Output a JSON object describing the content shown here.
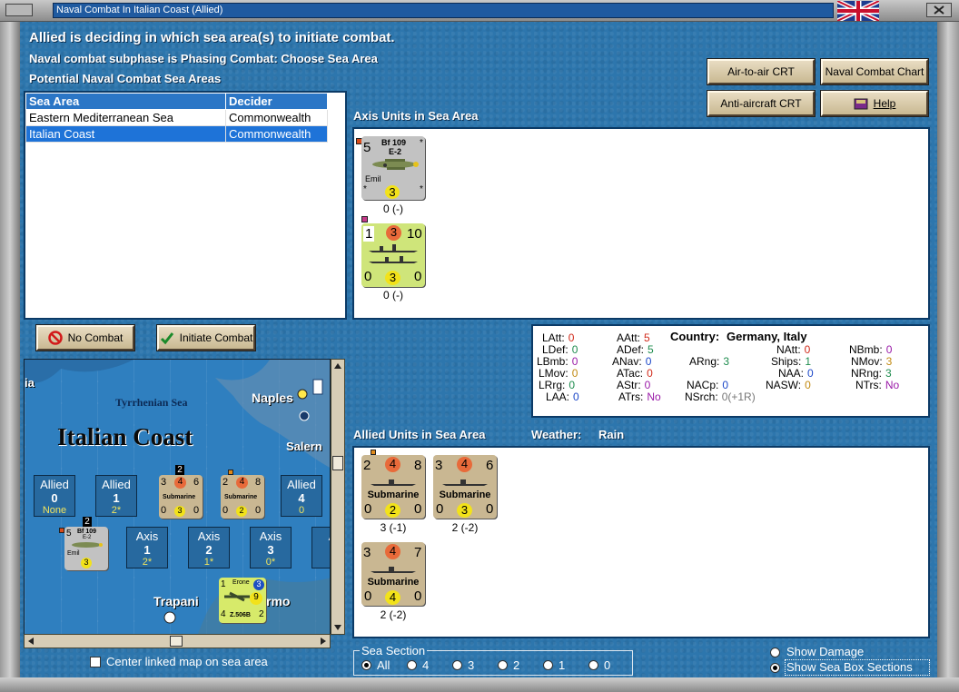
{
  "window": {
    "title": "Naval Combat In Italian Coast (Allied)"
  },
  "header": {
    "line1": "Allied is deciding in which sea area(s) to initiate combat.",
    "line2": "Naval combat subphase is Phasing Combat: Choose Sea Area",
    "line3": "Potential Naval Combat Sea Areas"
  },
  "buttons": {
    "air_to_air": "Air-to-air CRT",
    "naval_chart": "Naval Combat Chart",
    "anti_aircraft": "Anti-aircraft CRT",
    "help": "Help",
    "no_combat": "No Combat",
    "initiate_combat": "Initiate Combat"
  },
  "sea_table": {
    "headers": [
      "Sea Area",
      "Decider"
    ],
    "rows": [
      {
        "area": "Eastern Mediterranean Sea",
        "decider": "Commonwealth",
        "selected": false
      },
      {
        "area": "Italian Coast",
        "decider": "Commonwealth",
        "selected": true
      }
    ]
  },
  "axis_units": {
    "label": "Axis Units in Sea Area",
    "units": [
      {
        "type": "aircraft",
        "name": "Bf 109",
        "variant": "E-2",
        "nick": "Emil",
        "left": "5",
        "circle": "3",
        "caption": "0 (-)"
      },
      {
        "type": "ship",
        "top_left": "1",
        "top_circle": "3",
        "top_right": "10",
        "bot_left": "0",
        "bot_circle": "3",
        "bot_right": "0",
        "caption": "0 (-)"
      }
    ]
  },
  "stats": {
    "country_label": "Country:",
    "country": "Germany, Italy",
    "items": [
      {
        "k": "LAtt:",
        "v": "0",
        "c": "red"
      },
      {
        "k": "LDef:",
        "v": "0",
        "c": "grn"
      },
      {
        "k": "LBmb:",
        "v": "0",
        "c": "pur"
      },
      {
        "k": "LMov:",
        "v": "0",
        "c": "org"
      },
      {
        "k": "LRrg:",
        "v": "0",
        "c": "grn"
      },
      {
        "k": "LAA:",
        "v": "0",
        "c": "blu"
      },
      {
        "k": "AAtt:",
        "v": "5",
        "c": "red"
      },
      {
        "k": "ADef:",
        "v": "5",
        "c": "grn"
      },
      {
        "k": "ANav:",
        "v": "0",
        "c": "blu"
      },
      {
        "k": "ATac:",
        "v": "0",
        "c": "red"
      },
      {
        "k": "AStr:",
        "v": "0",
        "c": "pur"
      },
      {
        "k": "ATrs:",
        "v": "No",
        "c": "pur"
      },
      {
        "k": "ARng:",
        "v": "3",
        "c": "grn"
      },
      {
        "k": "NACp:",
        "v": "0",
        "c": "blu"
      },
      {
        "k": "NSrch:",
        "v": "0(+1R)",
        "c": "gry"
      },
      {
        "k": "NAtt:",
        "v": "0",
        "c": "red"
      },
      {
        "k": "Ships:",
        "v": "1",
        "c": "grn"
      },
      {
        "k": "NAA:",
        "v": "0",
        "c": "blu"
      },
      {
        "k": "NASW:",
        "v": "0",
        "c": "org"
      },
      {
        "k": "NBmb:",
        "v": "0",
        "c": "pur"
      },
      {
        "k": "NMov:",
        "v": "3",
        "c": "org"
      },
      {
        "k": "NRng:",
        "v": "3",
        "c": "grn"
      },
      {
        "k": "NTrs:",
        "v": "No",
        "c": "pur"
      }
    ]
  },
  "allied_units": {
    "label": "Allied Units in Sea Area",
    "weather_label": "Weather:",
    "weather": "Rain",
    "units": [
      {
        "name": "Submarine",
        "tl": "2",
        "tc": "4",
        "tr": "8",
        "bl": "0",
        "bc": "2",
        "br": "0",
        "caption": "3 (-1)"
      },
      {
        "name": "Submarine",
        "tl": "3",
        "tc": "4",
        "tr": "6",
        "bl": "0",
        "bc": "3",
        "br": "0",
        "caption": "2 (-2)"
      },
      {
        "name": "Submarine",
        "tl": "3",
        "tc": "4",
        "tr": "7",
        "bl": "0",
        "bc": "4",
        "br": "0",
        "caption": "2 (-2)"
      }
    ]
  },
  "map": {
    "sea_name": "Tyrrhenian Sea",
    "area_name": "Italian Coast",
    "cities": [
      "Naples",
      "Salern",
      "Trapani",
      "rmo",
      "ia"
    ],
    "allied_boxes": [
      {
        "a": "Allied",
        "b": "0",
        "c": "None"
      },
      {
        "a": "Allied",
        "b": "1",
        "c": "2*"
      },
      {
        "a": "Allied",
        "b": "4",
        "c": "0"
      }
    ],
    "axis_boxes": [
      {
        "a": "Axis",
        "b": "1",
        "c": "2*"
      },
      {
        "a": "Axis",
        "b": "2",
        "c": "1*"
      },
      {
        "a": "Axis",
        "b": "3",
        "c": "0*"
      }
    ],
    "stack_counts": [
      "2",
      "2"
    ],
    "sub_counters": [
      {
        "tl": "3",
        "tc": "4",
        "tr": "6",
        "bl": "0",
        "bc": "3",
        "br": "0",
        "name": "Submarine"
      },
      {
        "tl": "2",
        "tc": "4",
        "tr": "8",
        "bl": "0",
        "bc": "2",
        "br": "0",
        "name": "Submarine"
      }
    ],
    "erone": {
      "name": "Erone",
      "tl": "1",
      "tr": "3",
      "mid": "9",
      "bl": "4",
      "br": "2",
      "model": "Z.506B"
    },
    "map_bf": {
      "name": "Bf 109",
      "variant": "E-2",
      "nick": "Emil",
      "left": "5",
      "circle": "3"
    }
  },
  "options": {
    "center_linked": "Center linked map on sea area",
    "sea_section_label": "Sea Section",
    "sections": [
      "All",
      "4",
      "3",
      "2",
      "1",
      "0"
    ],
    "selected_section": "All",
    "show_damage": "Show Damage",
    "show_sea_box": "Show Sea Box Sections"
  }
}
